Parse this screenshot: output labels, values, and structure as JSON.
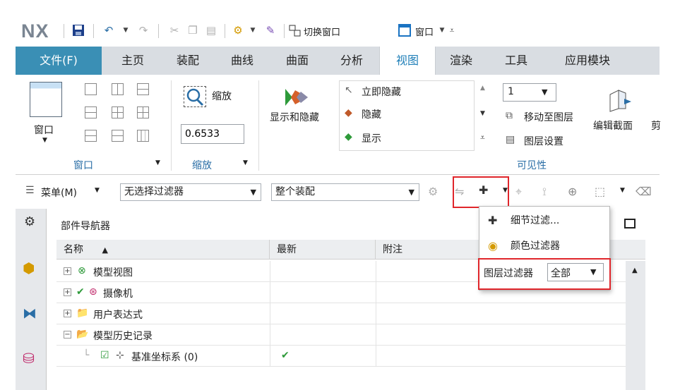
{
  "app": {
    "logo": "NX"
  },
  "qat": {
    "switch_window": "切换窗口",
    "window_menu": "窗口"
  },
  "tabs": [
    {
      "label": "文件(F)"
    },
    {
      "label": "主页"
    },
    {
      "label": "装配"
    },
    {
      "label": "曲线"
    },
    {
      "label": "曲面"
    },
    {
      "label": "分析"
    },
    {
      "label": "视图"
    },
    {
      "label": "渲染"
    },
    {
      "label": "工具"
    },
    {
      "label": "应用模块"
    }
  ],
  "ribbon": {
    "window_group": {
      "button": "窗口",
      "label": "窗口"
    },
    "zoom_group": {
      "zoom_button": "缩放",
      "zoom_value": "0.6533",
      "label": "缩放"
    },
    "visibility_group": {
      "show_hide": "显示和隐藏",
      "immediate_hide": "立即隐藏",
      "hide": "隐藏",
      "show": "显示",
      "layer_value": "1",
      "move_to_layer": "移动至图层",
      "layer_settings": "图层设置",
      "edit_section": "编辑截面",
      "cut": "剪",
      "label": "可见性"
    }
  },
  "filterbar": {
    "menu_label": "菜单(M)",
    "selection_filter": "无选择过滤器",
    "assembly_scope": "整个装配"
  },
  "navigator": {
    "title": "部件导航器",
    "columns": [
      "名称",
      "最新",
      "附注"
    ],
    "rows": [
      {
        "label": "模型视图"
      },
      {
        "label": "摄像机"
      },
      {
        "label": "用户表达式"
      },
      {
        "label": "模型历史记录"
      },
      {
        "label": "基准坐标系 (0)"
      }
    ]
  },
  "dropdown": {
    "detail_filter": "细节过滤...",
    "color_filter": "颜色过滤器",
    "layer_filter_label": "图层过滤器",
    "layer_filter_value": "全部"
  },
  "colors": {
    "file_tab": "#3a8fb5",
    "active_tab_text": "#1f7fb8",
    "highlight_red": "#e0262b",
    "group_label": "#2a6ea6"
  }
}
